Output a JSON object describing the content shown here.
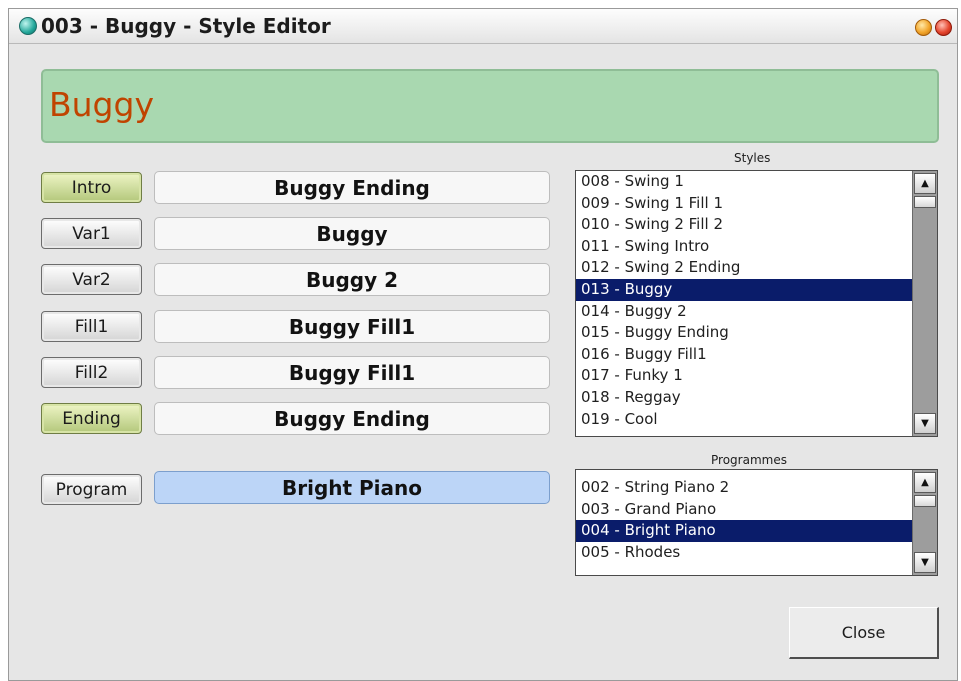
{
  "window": {
    "title": "003 - Buggy - Style Editor",
    "icon": "app-bullet-icon",
    "controls": [
      "minimize-icon",
      "close-icon"
    ]
  },
  "style_name": "Buggy",
  "slots": [
    {
      "label": "Intro",
      "value": "Buggy Ending",
      "active": true
    },
    {
      "label": "Var1",
      "value": "Buggy",
      "active": false
    },
    {
      "label": "Var2",
      "value": "Buggy 2",
      "active": false
    },
    {
      "label": "Fill1",
      "value": "Buggy Fill1",
      "active": false
    },
    {
      "label": "Fill2",
      "value": "Buggy Fill1",
      "active": false
    },
    {
      "label": "Ending",
      "value": "Buggy Ending",
      "active": true
    }
  ],
  "program": {
    "label": "Program",
    "value": "Bright Piano"
  },
  "styles_list": {
    "caption": "Styles",
    "items": [
      "008 - Swing 1",
      "009 - Swing 1 Fill 1",
      "010 - Swing 2 Fill 2",
      "011 - Swing Intro",
      "012 - Swing 2 Ending",
      "013 - Buggy",
      "014 - Buggy 2",
      "015 - Buggy Ending",
      "016 - Buggy Fill1",
      "017 - Funky 1",
      "018 - Reggay",
      "019 - Cool"
    ],
    "selected": "013 - Buggy"
  },
  "programmes_list": {
    "caption": "Programmes",
    "items": [
      "002 - String Piano 2",
      "003 - Grand Piano",
      "004 - Bright Piano",
      "005 - Rhodes"
    ],
    "selected": "004 - Bright Piano"
  },
  "close_label": "Close",
  "colors": {
    "name_panel": "#a9d8b0",
    "name_text": "#c04400",
    "selection": "#0a1c6a",
    "active_slot": "#b3c77a",
    "program_field": "#bcd5f7"
  }
}
